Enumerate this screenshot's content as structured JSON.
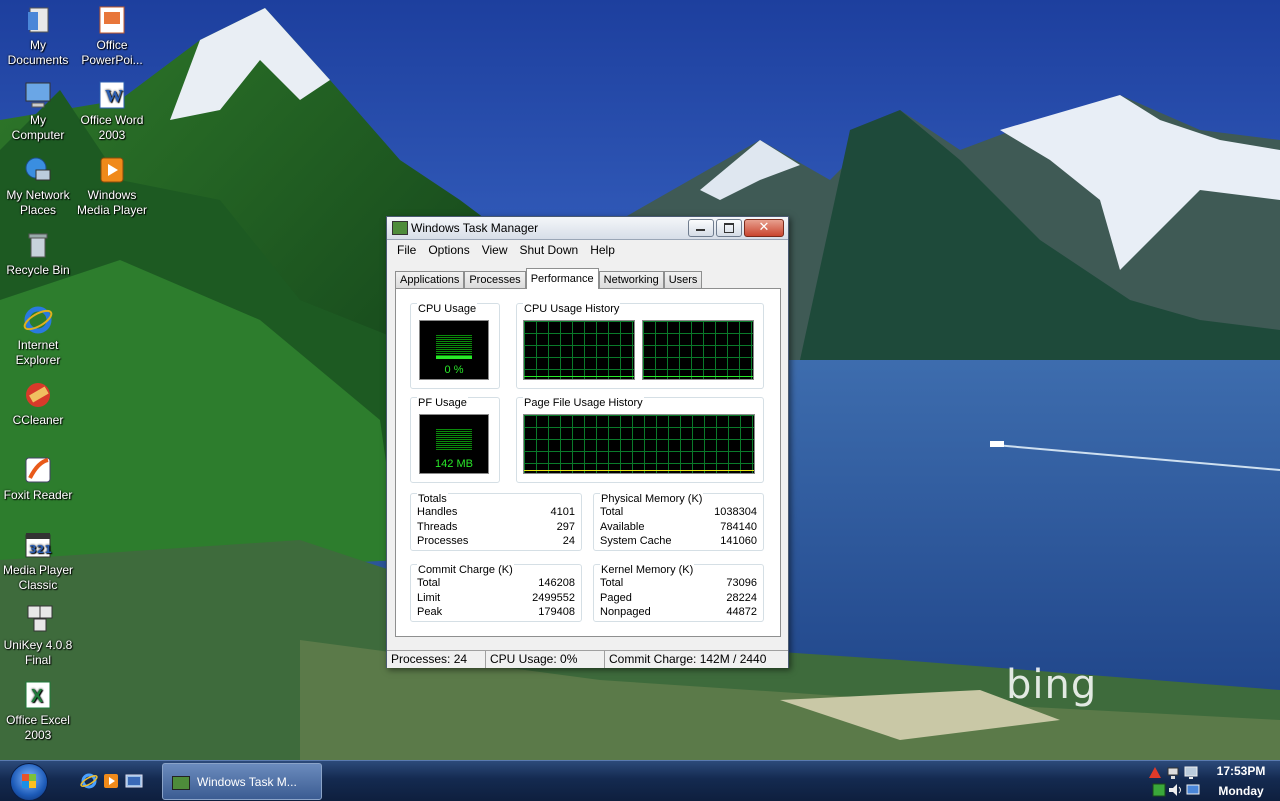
{
  "desktop": {
    "wallpaper_brand": "bing",
    "icons": [
      {
        "label": "My\nDocuments",
        "icon": "my-documents-icon"
      },
      {
        "label": "Office\nPowerPoi...",
        "icon": "powerpoint-icon"
      },
      {
        "label": "My\nComputer",
        "icon": "my-computer-icon"
      },
      {
        "label": "Office Word\n2003",
        "icon": "word-icon"
      },
      {
        "label": "My Network\nPlaces",
        "icon": "network-places-icon"
      },
      {
        "label": "Windows\nMedia Player",
        "icon": "media-player-icon"
      },
      {
        "label": "Recycle Bin",
        "icon": "recycle-bin-icon"
      },
      {
        "label": "Internet\nExplorer",
        "icon": "internet-explorer-icon"
      },
      {
        "label": "CCleaner",
        "icon": "ccleaner-icon"
      },
      {
        "label": "Foxit Reader",
        "icon": "foxit-reader-icon"
      },
      {
        "label": "Media Player\nClassic",
        "icon": "media-player-classic-icon"
      },
      {
        "label": "UniKey 4.0.8\nFinal",
        "icon": "unikey-icon"
      },
      {
        "label": "Office Excel\n2003",
        "icon": "excel-icon"
      }
    ]
  },
  "window": {
    "title": "Windows Task Manager",
    "menu": [
      "File",
      "Options",
      "View",
      "Shut Down",
      "Help"
    ],
    "tabs": [
      "Applications",
      "Processes",
      "Performance",
      "Networking",
      "Users"
    ],
    "active_tab": "Performance",
    "performance": {
      "cpu_usage_label": "CPU Usage",
      "cpu_usage_value": "0 %",
      "cpu_usage_percent": 0,
      "cpu_history_label": "CPU Usage History",
      "pf_usage_label": "PF Usage",
      "pf_usage_value": "142 MB",
      "pf_history_label": "Page File Usage History",
      "totals": {
        "label": "Totals",
        "rows": [
          {
            "name": "Handles",
            "value": "4101"
          },
          {
            "name": "Threads",
            "value": "297"
          },
          {
            "name": "Processes",
            "value": "24"
          }
        ]
      },
      "physical_memory": {
        "label": "Physical Memory (K)",
        "rows": [
          {
            "name": "Total",
            "value": "1038304"
          },
          {
            "name": "Available",
            "value": "784140"
          },
          {
            "name": "System Cache",
            "value": "141060"
          }
        ]
      },
      "commit_charge": {
        "label": "Commit Charge (K)",
        "rows": [
          {
            "name": "Total",
            "value": "146208"
          },
          {
            "name": "Limit",
            "value": "2499552"
          },
          {
            "name": "Peak",
            "value": "179408"
          }
        ]
      },
      "kernel_memory": {
        "label": "Kernel Memory (K)",
        "rows": [
          {
            "name": "Total",
            "value": "73096"
          },
          {
            "name": "Paged",
            "value": "28224"
          },
          {
            "name": "Nonpaged",
            "value": "44872"
          }
        ]
      }
    },
    "status": {
      "processes": "Processes: 24",
      "cpu": "CPU Usage: 0%",
      "commit": "Commit Charge: 142M / 2440"
    }
  },
  "taskbar": {
    "quick_launch": [
      "internet-explorer-icon",
      "media-player-icon",
      "show-desktop-icon"
    ],
    "task_button": "Windows Task M...",
    "clock_time": "17:53PM",
    "clock_day": "Monday"
  }
}
